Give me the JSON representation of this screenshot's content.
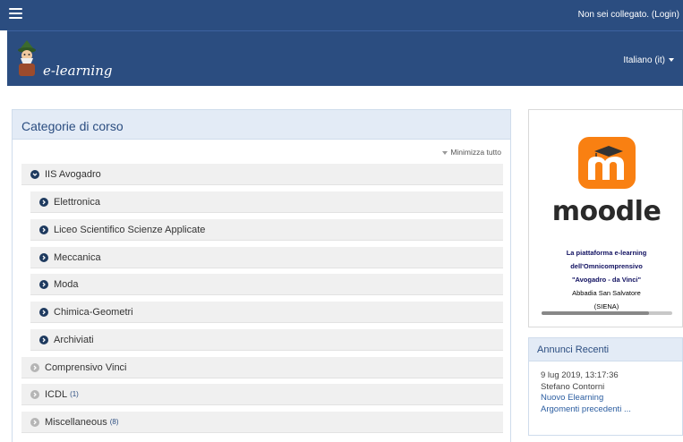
{
  "topbar": {
    "menu_icon": "hamburger-menu-icon",
    "login_text": "Non sei collegato. (Login)"
  },
  "header": {
    "logo_icon": "wizard-mascot-icon",
    "brand": "e-learning",
    "language": "Italiano (it)",
    "language_caret_icon": "caret-down-icon"
  },
  "categories": {
    "title": "Categorie di corso",
    "collapse_all": "Minimizza tutto",
    "items": [
      {
        "label": "IIS Avogadro",
        "count": "",
        "expanded": true,
        "icon": "circle-chevron-down-icon"
      },
      {
        "label": "Elettronica",
        "count": "",
        "icon": "circle-chevron-right-icon"
      },
      {
        "label": "Liceo Scientifico Scienze Applicate",
        "count": "",
        "icon": "circle-chevron-right-icon"
      },
      {
        "label": "Meccanica",
        "count": "",
        "icon": "circle-chevron-right-icon"
      },
      {
        "label": "Moda",
        "count": "",
        "icon": "circle-chevron-right-icon"
      },
      {
        "label": "Chimica-Geometri",
        "count": "",
        "icon": "circle-chevron-right-icon"
      },
      {
        "label": "Archiviati",
        "count": "",
        "icon": "circle-chevron-right-icon"
      },
      {
        "label": "Comprensivo Vinci",
        "count": "",
        "icon": "circle-chevron-right-icon"
      },
      {
        "label": "ICDL",
        "count": "(1)",
        "icon": "circle-chevron-right-icon"
      },
      {
        "label": "Miscellaneous",
        "count": "(8)",
        "icon": "circle-chevron-right-icon"
      }
    ]
  },
  "moodle_block": {
    "logo_icon": "moodle-logo-icon",
    "wordmark": "moodle",
    "line1": "La piattaforma e-learning",
    "line2": "dell'Omnicomprensivo",
    "line3": "\"Avogadro - da Vinci\"",
    "line4": "Abbadia San Salvatore",
    "line5": "(SIENA)"
  },
  "news": {
    "title": "Annunci Recenti",
    "date": "9 lug 2019, 13:17:36",
    "author": "Stefano Contorni",
    "post_link": "Nuovo Elearning",
    "older_link": "Argomenti precedenti ..."
  },
  "colors": {
    "navbar": "#2b4d80",
    "card_header": "#e3ebf6",
    "moodle_orange": "#f98012",
    "link": "#2b5da0"
  }
}
